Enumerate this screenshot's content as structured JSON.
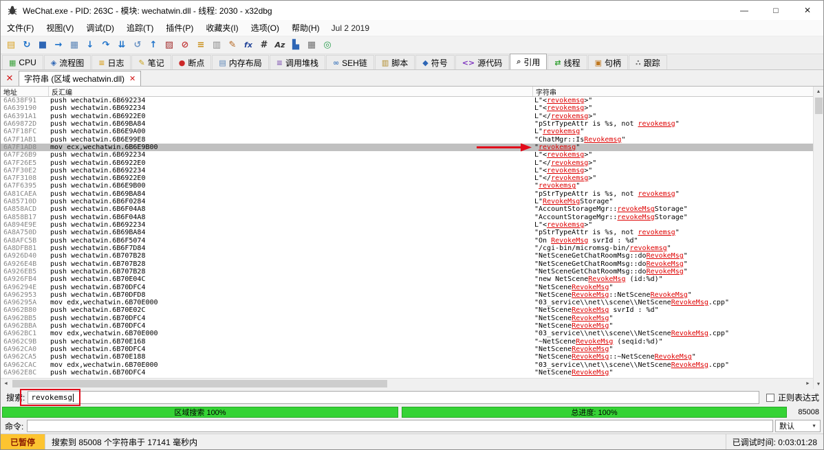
{
  "window": {
    "title": "WeChat.exe - PID: 263C - 模块: wechatwin.dll - 线程: 2030 - x32dbg",
    "controls": {
      "minimize": "—",
      "maximize": "□",
      "close": "✕"
    }
  },
  "menu": {
    "items": [
      "文件(F)",
      "视图(V)",
      "调试(D)",
      "追踪(T)",
      "插件(P)",
      "收藏夹(I)",
      "选项(O)",
      "帮助(H)"
    ],
    "build_date": "Jul 2 2019"
  },
  "toolbar": {
    "icons": [
      {
        "name": "open-file-icon",
        "glyph": "▤",
        "color": "#D9A326"
      },
      {
        "name": "restart-icon",
        "glyph": "↻",
        "color": "#1C71C9"
      },
      {
        "name": "stop-icon",
        "glyph": "■",
        "color": "#2E66B5"
      },
      {
        "name": "run-icon",
        "glyph": "→",
        "color": "#1C71C9"
      },
      {
        "name": "pause-icon",
        "glyph": "▦",
        "color": "#5E87B8"
      },
      {
        "name": "step-into-icon",
        "glyph": "↓",
        "color": "#1C71C9"
      },
      {
        "name": "step-over-icon",
        "glyph": "↷",
        "color": "#1C71C9"
      },
      {
        "name": "execute-return-icon",
        "glyph": "⇊",
        "color": "#1C71C9"
      },
      {
        "name": "step-back-icon",
        "glyph": "↺",
        "color": "#6A93C4"
      },
      {
        "name": "run-trace-icon",
        "glyph": "↑",
        "color": "#1C71C9"
      },
      {
        "name": "patches-icon",
        "glyph": "▨",
        "color": "#A12B2B"
      },
      {
        "name": "breakpoint-toggle-icon",
        "glyph": "⊘",
        "color": "#C23B3B"
      },
      {
        "name": "log-icon",
        "glyph": "≡",
        "color": "#C9901C"
      },
      {
        "name": "memory-icon",
        "glyph": "▥",
        "color": "#8A8A8A"
      },
      {
        "name": "patch-pencil-icon",
        "glyph": "✎",
        "color": "#B5651D"
      },
      {
        "name": "favourite-functions-icon",
        "glyph": "fx",
        "color": "#28499B"
      },
      {
        "name": "hash-icon",
        "glyph": "#",
        "color": "#333333"
      },
      {
        "name": "case-sensitive-icon",
        "glyph": "Az",
        "color": "#333333"
      },
      {
        "name": "graph-icon",
        "glyph": "▙",
        "color": "#2E66B5"
      },
      {
        "name": "calculator-icon",
        "glyph": "▦",
        "color": "#707070"
      },
      {
        "name": "seh-globe-icon",
        "glyph": "◎",
        "color": "#2A9D4E"
      }
    ]
  },
  "tabs": [
    {
      "name": "tab-cpu",
      "label": "CPU",
      "glyph": "▦",
      "color": "#3AA23A",
      "active": false
    },
    {
      "name": "tab-graph",
      "label": "流程图",
      "glyph": "◈",
      "color": "#2E66B5",
      "active": false
    },
    {
      "name": "tab-log",
      "label": "日志",
      "glyph": "≡",
      "color": "#D9A326",
      "active": false
    },
    {
      "name": "tab-notes",
      "label": "笔记",
      "glyph": "✎",
      "color": "#C9A21C",
      "active": false
    },
    {
      "name": "tab-breakpoints",
      "label": "断点",
      "glyph": "●",
      "color": "#CC2929",
      "active": false
    },
    {
      "name": "tab-memory-map",
      "label": "内存布局",
      "glyph": "▤",
      "color": "#5E87B8",
      "active": false
    },
    {
      "name": "tab-call-stack",
      "label": "调用堆栈",
      "glyph": "≡",
      "color": "#8A63B8",
      "active": false
    },
    {
      "name": "tab-seh",
      "label": "SEH链",
      "glyph": "∞",
      "color": "#4A7FBF",
      "active": false
    },
    {
      "name": "tab-script",
      "label": "脚本",
      "glyph": "▥",
      "color": "#B08A28",
      "active": false
    },
    {
      "name": "tab-symbols",
      "label": "符号",
      "glyph": "◆",
      "color": "#2E66B5",
      "active": false
    },
    {
      "name": "tab-source",
      "label": "源代码",
      "glyph": "<>",
      "color": "#7B2FBE",
      "active": false
    },
    {
      "name": "tab-references",
      "label": "引用",
      "glyph": "⌕",
      "color": "#3A3A3A",
      "active": true
    },
    {
      "name": "tab-threads",
      "label": "线程",
      "glyph": "⇄",
      "color": "#2D9E2D",
      "active": false
    },
    {
      "name": "tab-handles",
      "label": "句柄",
      "glyph": "▣",
      "color": "#C07820",
      "active": false
    },
    {
      "name": "tab-trace",
      "label": "跟踪",
      "glyph": "∴",
      "color": "#707070",
      "active": false
    }
  ],
  "subtab": {
    "close_all_glyph": "✕",
    "label": "字符串 (区域 wechatwin.dll)",
    "close_glyph": "✕"
  },
  "table": {
    "columns": [
      "地址",
      "反汇编",
      "字符串"
    ],
    "highlight_term": "revokemsg",
    "selected_address": "6A7F1AD8",
    "rows": [
      [
        "6A638F91",
        "push wechatwin.6B692234",
        "L\"<revokemsg>\""
      ],
      [
        "6A639190",
        "push wechatwin.6B692234",
        "L\"<revokemsg>\""
      ],
      [
        "6A6391A1",
        "push wechatwin.6B6922E0",
        "L\"</revokemsg>\""
      ],
      [
        "6A69872D",
        "push wechatwin.6B69BA84",
        "\"pStrTypeAttr is %s, not revokemsg\""
      ],
      [
        "6A7F18FC",
        "push wechatwin.6B6E9A00",
        "L\"revokemsg\""
      ],
      [
        "6A7F1AB1",
        "push wechatwin.6B6E99E8",
        "\"ChatMgr::IsRevokemsg\""
      ],
      [
        "6A7F1AD8",
        "mov ecx,wechatwin.6B6E9B00",
        "\"revokemsg\""
      ],
      [
        "6A7F26B9",
        "push wechatwin.6B692234",
        "L\"<revokemsg>\""
      ],
      [
        "6A7F26E5",
        "push wechatwin.6B6922E0",
        "L\"</revokemsg>\""
      ],
      [
        "6A7F30E2",
        "push wechatwin.6B692234",
        "L\"<revokemsg>\""
      ],
      [
        "6A7F3108",
        "push wechatwin.6B6922E0",
        "L\"</revokemsg>\""
      ],
      [
        "6A7F6395",
        "push wechatwin.6B6E9B00",
        "\"revokemsg\""
      ],
      [
        "6A81CAEA",
        "push wechatwin.6B69BA84",
        "\"pStrTypeAttr is %s, not revokemsg\""
      ],
      [
        "6A85710D",
        "push wechatwin.6B6F0284",
        "L\"RevokeMsgStorage\""
      ],
      [
        "6A858ACD",
        "push wechatwin.6B6F04A8",
        "\"AccountStorageMgr::revokeMsgStorage\""
      ],
      [
        "6A858B17",
        "push wechatwin.6B6F04A8",
        "\"AccountStorageMgr::revokeMsgStorage\""
      ],
      [
        "6A894E9E",
        "push wechatwin.6B692234",
        "L\"<revokemsg>\""
      ],
      [
        "6A8A750D",
        "push wechatwin.6B69BA84",
        "\"pStrTypeAttr is %s, not revokemsg\""
      ],
      [
        "6A8AFC5B",
        "push wechatwin.6B6F5074",
        "\"On RevokeMsg svrId : %d\""
      ],
      [
        "6A8DFB81",
        "push wechatwin.6B6F7D84",
        "\"/cgi-bin/micromsg-bin/revokemsg\""
      ],
      [
        "6A926D40",
        "push wechatwin.6B707B28",
        "\"NetSceneGetChatRoomMsg::doRevokeMsg\""
      ],
      [
        "6A926E4B",
        "push wechatwin.6B707B28",
        "\"NetSceneGetChatRoomMsg::doRevokeMsg\""
      ],
      [
        "6A926EB5",
        "push wechatwin.6B707B28",
        "\"NetSceneGetChatRoomMsg::doRevokeMsg\""
      ],
      [
        "6A926FB4",
        "push wechatwin.6B70E04C",
        "\"new NetSceneRevokeMsg (id:%d)\""
      ],
      [
        "6A96294E",
        "push wechatwin.6B70DFC4",
        "\"NetSceneRevokeMsg\""
      ],
      [
        "6A962953",
        "push wechatwin.6B70DFD8",
        "\"NetSceneRevokeMsg::NetSceneRevokeMsg\""
      ],
      [
        "6A96295A",
        "mov edx,wechatwin.6B70E000",
        "\"03_service\\\\net\\\\scene\\\\NetSceneRevokeMsg.cpp\""
      ],
      [
        "6A962B80",
        "push wechatwin.6B70E02C",
        "\"NetSceneRevokeMsg svrId : %d\""
      ],
      [
        "6A962BB5",
        "push wechatwin.6B70DFC4",
        "\"NetSceneRevokeMsg\""
      ],
      [
        "6A962BBA",
        "push wechatwin.6B70DFC4",
        "\"NetSceneRevokeMsg\""
      ],
      [
        "6A962BC1",
        "mov edx,wechatwin.6B70E000",
        "\"03_service\\\\net\\\\scene\\\\NetSceneRevokeMsg.cpp\""
      ],
      [
        "6A962C9B",
        "push wechatwin.6B70E168",
        "\"~NetSceneRevokeMsg (seqid:%d)\""
      ],
      [
        "6A962CA0",
        "push wechatwin.6B70DFC4",
        "\"NetSceneRevokeMsg\""
      ],
      [
        "6A962CA5",
        "push wechatwin.6B70E188",
        "\"NetSceneRevokeMsg::~NetSceneRevokeMsg\""
      ],
      [
        "6A962CAC",
        "mov edx,wechatwin.6B70E000",
        "\"03_service\\\\net\\\\scene\\\\NetSceneRevokeMsg.cpp\""
      ],
      [
        "6A962E8C",
        "push wechatwin.6B70DFC4",
        "\"NetSceneRevokeMsg\""
      ]
    ]
  },
  "scrollbar": {
    "up": "▲",
    "down": "▼",
    "left": "◄",
    "right": "►"
  },
  "search": {
    "label": "搜索:",
    "value": "revokemsg",
    "regex_label": "正则表达式"
  },
  "progress": {
    "region_label": "区域搜索 100%",
    "total_label": "总进度: 100%",
    "count": "85008"
  },
  "command": {
    "label": "命令:",
    "value": "",
    "combo": "默认",
    "combo_arrow": "▼"
  },
  "status": {
    "state": "已暂停",
    "message": "搜索到 85008 个字符串于 17141 毫秒内",
    "debug_time": "已调试时间: 0:03:01:28"
  },
  "colors": {
    "accent_red": "#DE0000",
    "selection": "#C0C0C0",
    "progress_green": "#35D335",
    "paused_yellow": "#FDC431"
  }
}
